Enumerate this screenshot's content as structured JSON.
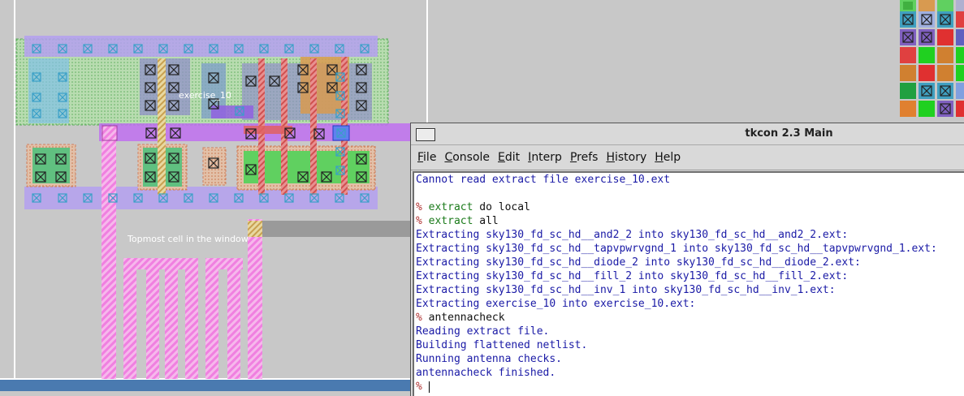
{
  "layout_view": {
    "cell_label": "exercise_10",
    "topmost_label": "Topmost cell in the window"
  },
  "tkcon": {
    "title": "tkcon 2.3 Main",
    "menus": [
      {
        "label": "File"
      },
      {
        "label": "Console"
      },
      {
        "label": "Edit"
      },
      {
        "label": "Interp"
      },
      {
        "label": "Prefs"
      },
      {
        "label": "History"
      },
      {
        "label": "Help"
      }
    ],
    "lines": [
      {
        "type": "out",
        "text": "Cannot read extract file exercise_10.ext"
      },
      {
        "type": "blank",
        "text": ""
      },
      {
        "type": "cmd",
        "prompt": "%",
        "keyword": "extract",
        "rest": " do local"
      },
      {
        "type": "cmd",
        "prompt": "%",
        "keyword": "extract",
        "rest": " all"
      },
      {
        "type": "out",
        "text": "Extracting sky130_fd_sc_hd__and2_2 into sky130_fd_sc_hd__and2_2.ext:"
      },
      {
        "type": "out",
        "text": "Extracting sky130_fd_sc_hd__tapvpwrvgnd_1 into sky130_fd_sc_hd__tapvpwrvgnd_1.ext:"
      },
      {
        "type": "out",
        "text": "Extracting sky130_fd_sc_hd__diode_2 into sky130_fd_sc_hd__diode_2.ext:"
      },
      {
        "type": "out",
        "text": "Extracting sky130_fd_sc_hd__fill_2 into sky130_fd_sc_hd__fill_2.ext:"
      },
      {
        "type": "out",
        "text": "Extracting sky130_fd_sc_hd__inv_1 into sky130_fd_sc_hd__inv_1.ext:"
      },
      {
        "type": "out",
        "text": "Extracting exercise_10 into exercise_10.ext:"
      },
      {
        "type": "cmd",
        "prompt": "%",
        "keyword": "",
        "rest": " antennacheck"
      },
      {
        "type": "out",
        "text": "Reading extract file."
      },
      {
        "type": "out",
        "text": "Building flattened netlist."
      },
      {
        "type": "out",
        "text": "Running antenna checks."
      },
      {
        "type": "out",
        "text": "antennacheck finished."
      },
      {
        "type": "input",
        "prompt": "%",
        "rest": " "
      }
    ]
  },
  "colors": {
    "background": "#c8c8c8",
    "metal1": "#b4a0f0",
    "ndiff": "#60d060",
    "pdiff": "#d89a50",
    "poly": "#e06060",
    "metal2_pink": "#f080e0",
    "console_text": "#1a1aa6"
  }
}
